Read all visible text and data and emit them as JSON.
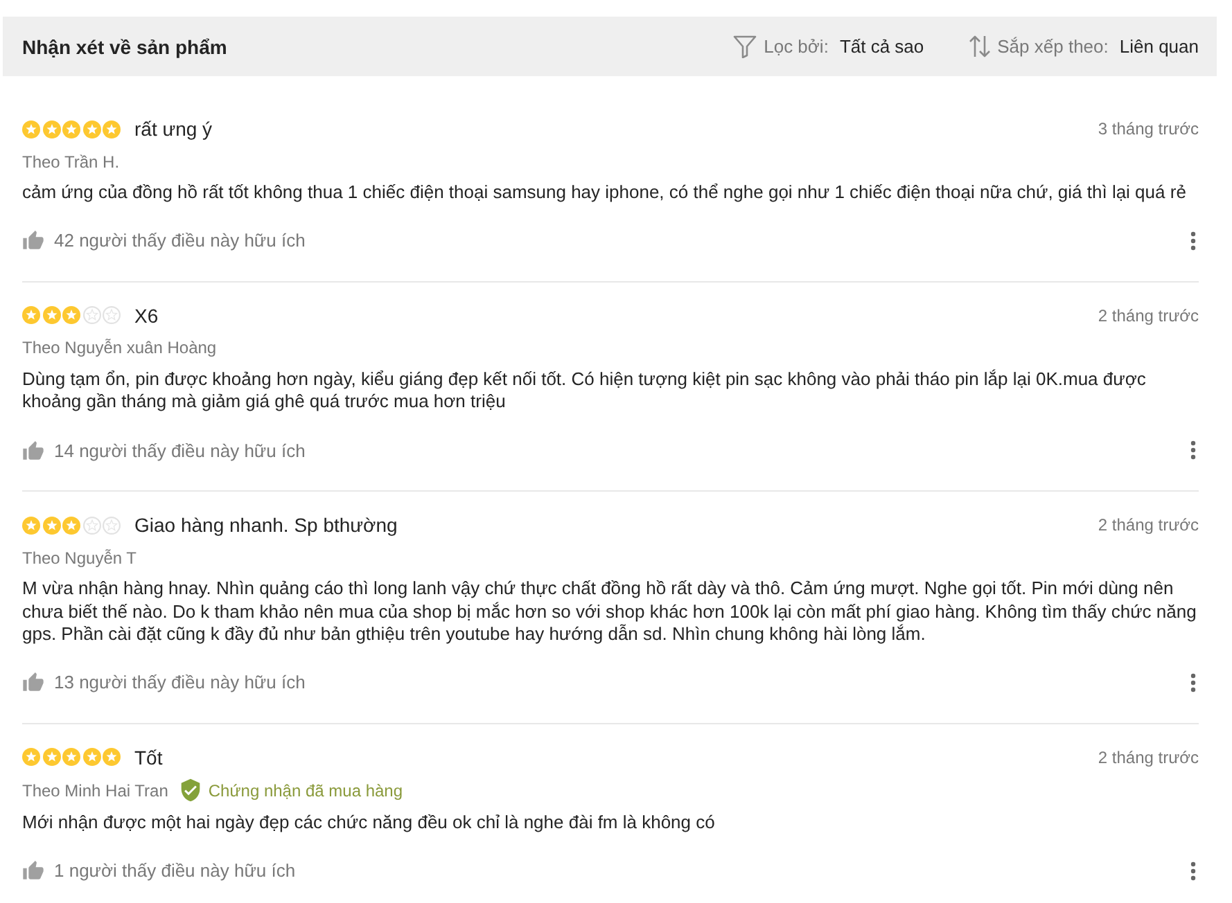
{
  "header": {
    "title": "Nhận xét về sản phẩm",
    "filter": {
      "label": "Lọc bởi:",
      "value": "Tất cả sao"
    },
    "sort": {
      "label": "Sắp xếp theo:",
      "value": "Liên quan"
    }
  },
  "reviews": [
    {
      "stars": 5,
      "title": "rất ưng ý",
      "date": "3 tháng trước",
      "author": "Theo Trần H.",
      "text": "cảm ứng của đồng hồ rất tốt không thua 1 chiếc điện thoại samsung hay iphone, có thể nghe gọi như 1 chiếc điện thoại nữa chứ, giá thì lại quá rẻ",
      "helpful": "42 người thấy điều này hữu ích"
    },
    {
      "stars": 3,
      "title": "X6",
      "date": "2 tháng trước",
      "author": "Theo Nguyễn xuân Hoàng",
      "text": "Dùng tạm ổn, pin được khoảng hơn ngày, kiểu giáng đẹp kết nối tốt. Có hiện tượng kiệt pin sạc không vào phải tháo pin lắp lại 0K.mua được khoảng gần tháng mà giảm giá ghê quá trước mua hơn triệu",
      "helpful": "14 người thấy điều này hữu ích"
    },
    {
      "stars": 3,
      "title": "Giao hàng nhanh. Sp bthường",
      "date": "2 tháng trước",
      "author": "Theo Nguyễn T",
      "text": "M vừa nhận hàng hnay. Nhìn quảng cáo thì long lanh vậy chứ thực chất đồng hồ rất dày và thô. Cảm ứng mượt. Nghe gọi tốt. Pin mới dùng nên chưa biết thế nào. Do k tham khảo nên mua của shop bị mắc hơn so với shop khác hơn 100k lại còn mất phí giao hàng. Không tìm thấy chức năng gps. Phần cài đặt cũng k đầy đủ như bản gthiệu trên youtube hay hướng dẫn sd. Nhìn chung không hài lòng lắm.",
      "helpful": "13 người thấy điều này hữu ích"
    },
    {
      "stars": 5,
      "title": "Tốt",
      "date": "2 tháng trước",
      "author": "Theo Minh Hai Tran",
      "badge": "Chứng nhận đã mua hàng",
      "text": "Mới nhận được một hai ngày đẹp các chức năng đều ok chỉ là nghe đài fm là không có",
      "helpful": "1 người thấy điều này hữu ích"
    }
  ]
}
